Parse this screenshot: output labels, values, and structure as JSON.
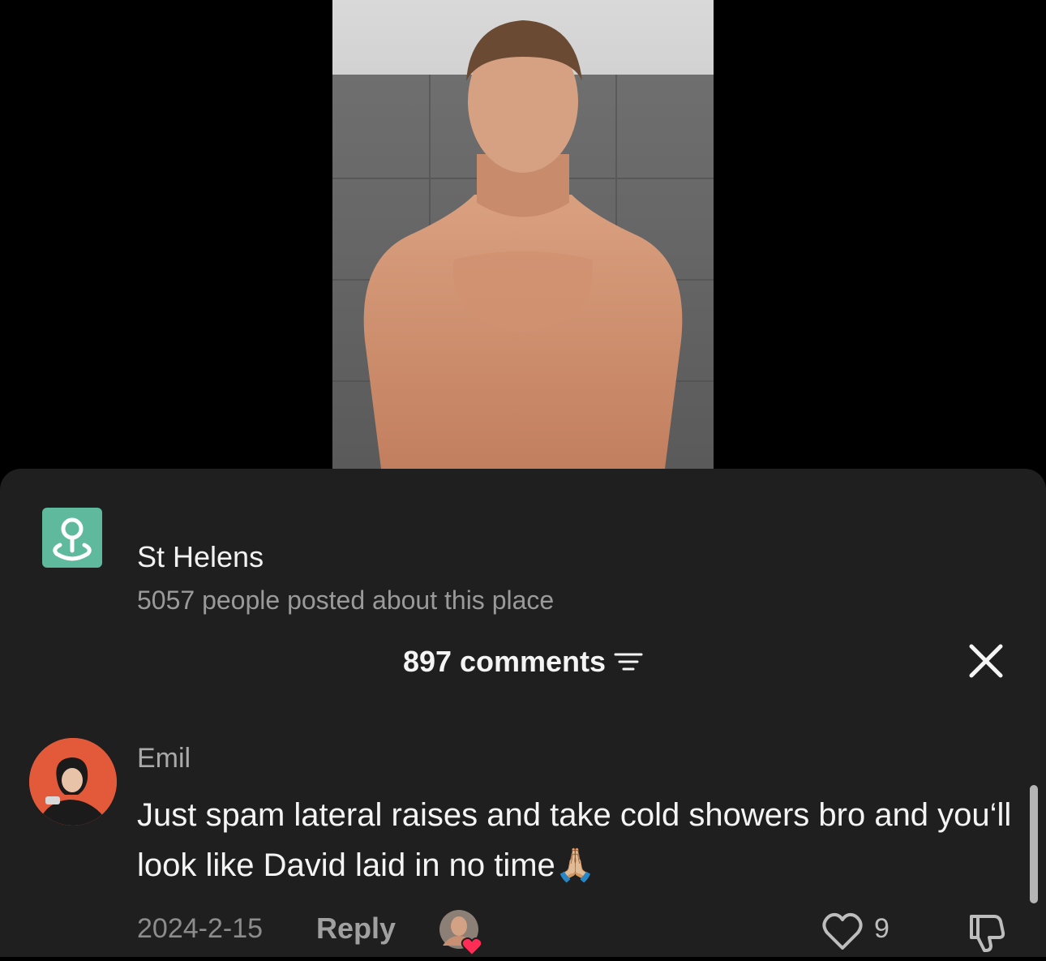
{
  "location": {
    "name": "St Helens",
    "subtitle": "5057 people posted about this place",
    "icon": "location-pin-icon",
    "icon_color": "#5fb99c"
  },
  "comments_header": {
    "title": "897 comments",
    "filter_icon": "filter-lines-icon",
    "close_icon": "close-icon"
  },
  "comment": {
    "username": "Emil",
    "text": "Just spam lateral raises and take cold showers bro and you‘ll look like David laid in no time🙏🏼",
    "date": "2024-2-15",
    "reply_label": "Reply",
    "like_count": "9",
    "avatar_bg": "#e25a3a"
  },
  "colors": {
    "sheet_bg": "#1f1f1f",
    "heart_red": "#ff2d55"
  }
}
